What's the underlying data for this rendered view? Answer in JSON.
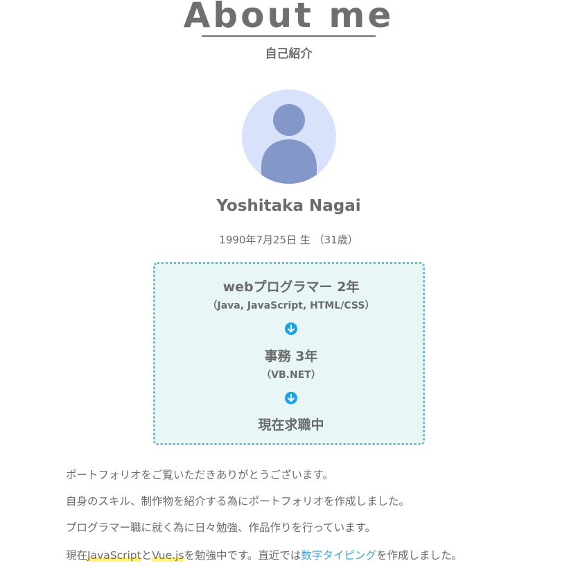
{
  "header": {
    "title": "About me",
    "subtitle": "自己紹介"
  },
  "profile": {
    "avatar_icon": "person-icon",
    "name": "Yoshitaka Nagai",
    "birth": "1990年7月25日 生 （31歳）"
  },
  "career": {
    "items": [
      {
        "title": "webプログラマー 2年",
        "sub": "（Java, JavaScript, HTML/CSS）"
      },
      {
        "title": "事務 3年",
        "sub": "（VB.NET）"
      },
      {
        "title": "現在求職中",
        "sub": ""
      }
    ],
    "arrow_icon": "arrow-down-circle-icon",
    "colors": {
      "border": "#6fbac0",
      "background": "#e8f6f6",
      "arrow": "#1aa3e0"
    }
  },
  "intro": {
    "line1": "ポートフォリオをご覧いただきありがとうございます。",
    "line2": "自身のスキル、制作物を紹介する為にポートフォリオを作成しました。",
    "line3": "プログラマー職に就く為に日々勉強、作品作りを行っています。",
    "line4_prefix": "現在",
    "line4_hl1": "JavaScript",
    "line4_mid1": "と",
    "line4_hl2": "Vue.js",
    "line4_mid2": "を勉強中です。直近では",
    "line4_link": "数字タイピング",
    "line4_suffix": "を作成しました。"
  },
  "colors": {
    "text": "#6b6b6b",
    "link": "#3fa3d4",
    "highlight": "#fff176",
    "avatar_bg": "#d8e2fb",
    "avatar_fg": "#8497c9"
  }
}
